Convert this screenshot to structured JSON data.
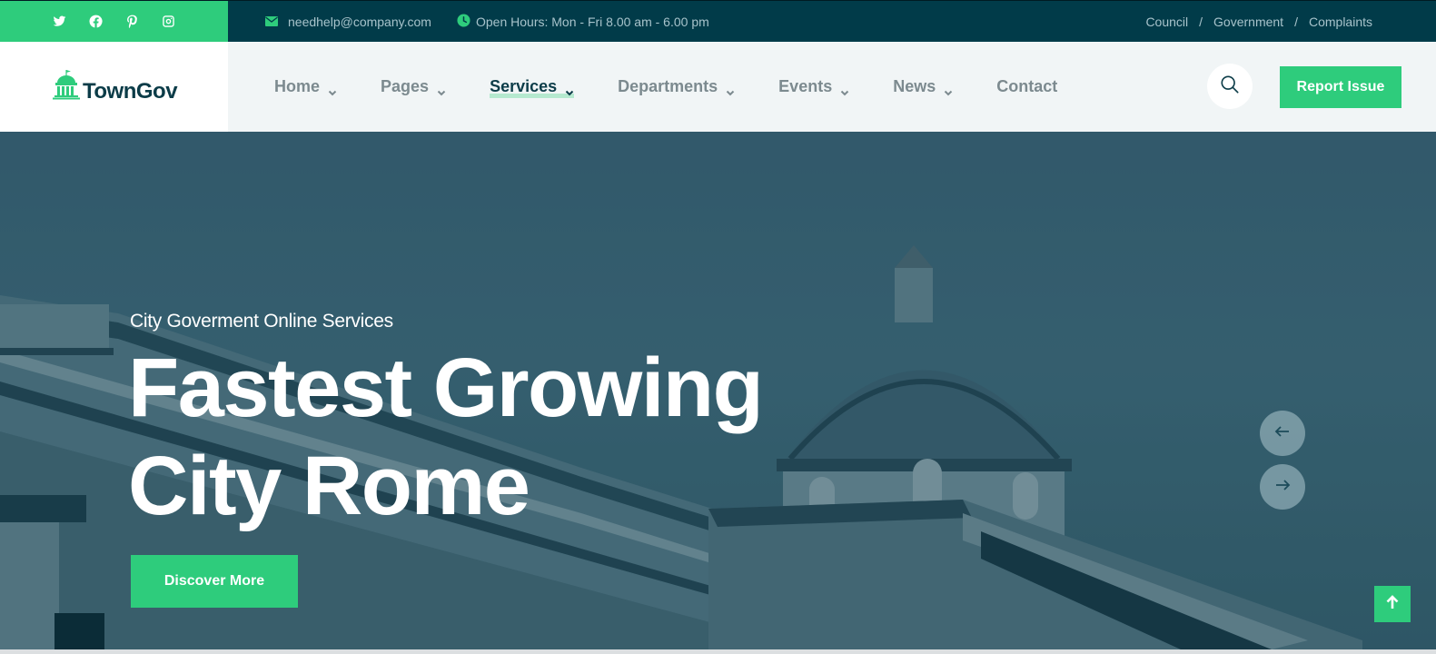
{
  "topbar": {
    "social": [
      {
        "name": "twitter-icon"
      },
      {
        "name": "facebook-icon"
      },
      {
        "name": "pinterest-icon"
      },
      {
        "name": "instagram-icon"
      }
    ],
    "email_icon": "envelope-icon",
    "email": "needhelp@company.com",
    "hours_icon": "clock-icon",
    "hours": "Open Hours: Mon - Fri 8.00 am - 6.00 pm",
    "links": [
      "Council",
      "Government",
      "Complaints"
    ],
    "separator": "/"
  },
  "header": {
    "logo": {
      "icon": "capitol-building-icon",
      "text": "TownGov"
    },
    "nav": [
      {
        "label": "Home",
        "has_dropdown": true,
        "active": false
      },
      {
        "label": "Pages",
        "has_dropdown": true,
        "active": false
      },
      {
        "label": "Services",
        "has_dropdown": true,
        "active": true
      },
      {
        "label": "Departments",
        "has_dropdown": true,
        "active": false
      },
      {
        "label": "Events",
        "has_dropdown": true,
        "active": false
      },
      {
        "label": "News",
        "has_dropdown": true,
        "active": false
      },
      {
        "label": "Contact",
        "has_dropdown": false,
        "active": false
      }
    ],
    "search_icon": "search-icon",
    "report_label": "Report Issue"
  },
  "hero": {
    "subtitle": "City Goverment Online Services",
    "title_line1": "Fastest Growing",
    "title_line2": "City Rome",
    "cta_label": "Discover More",
    "prev_icon": "arrow-left-icon",
    "next_icon": "arrow-right-icon",
    "back_to_top_icon": "arrow-up-icon"
  },
  "colors": {
    "accent": "#2ecc7c",
    "topbar_bg": "#013b49",
    "header_bg": "#f1f5f6",
    "nav_text": "#7c8a8f",
    "nav_active": "#0c3c48",
    "hero_tint": "#44687a"
  }
}
